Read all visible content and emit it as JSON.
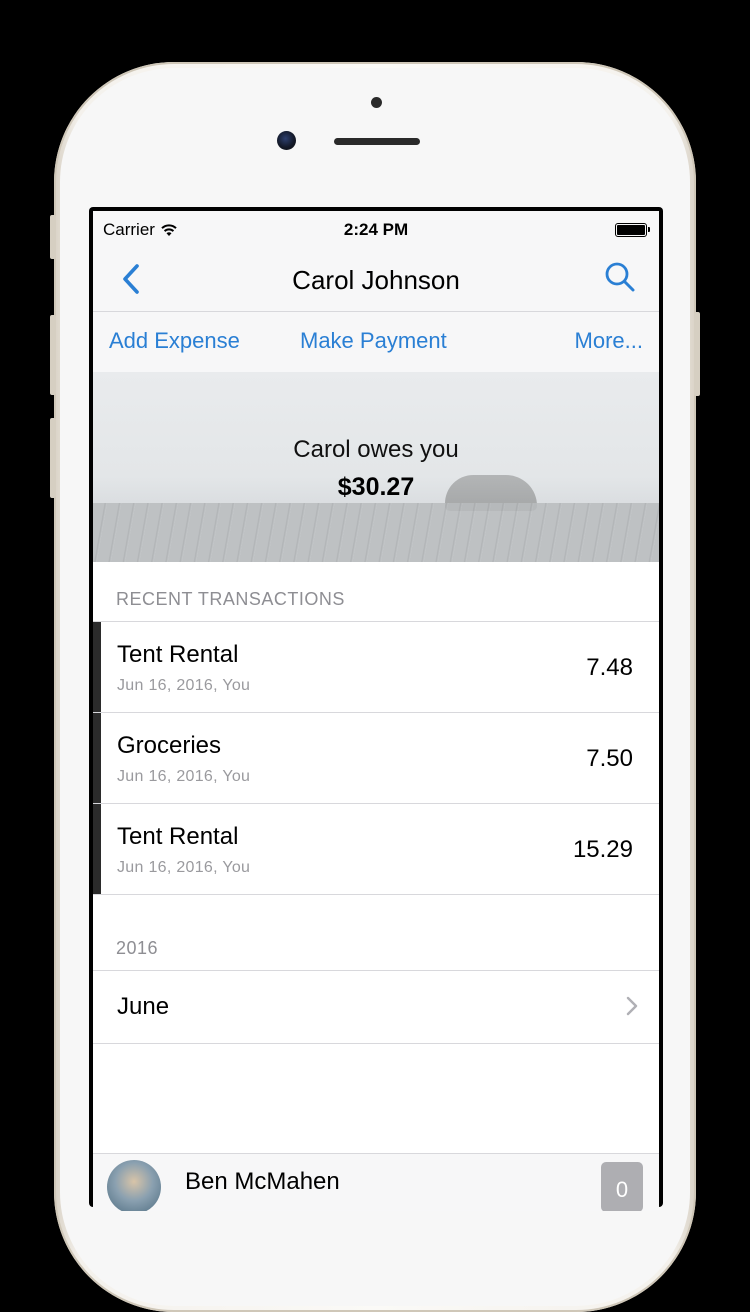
{
  "status_bar": {
    "carrier": "Carrier",
    "time": "2:24 PM"
  },
  "nav": {
    "title": "Carol Johnson",
    "back_icon": "chevron-left-icon",
    "search_icon": "search-icon"
  },
  "actions": {
    "add_expense": "Add Expense",
    "make_payment": "Make Payment",
    "more": "More..."
  },
  "balance": {
    "message": "Carol owes you",
    "amount": "$30.27"
  },
  "recent": {
    "header": "RECENT TRANSACTIONS",
    "items": [
      {
        "title": "Tent Rental",
        "subtitle": "Jun 16, 2016, You",
        "amount": "7.48"
      },
      {
        "title": "Groceries",
        "subtitle": "Jun 16, 2016, You",
        "amount": "7.50"
      },
      {
        "title": "Tent Rental",
        "subtitle": "Jun 16, 2016, You",
        "amount": "15.29"
      }
    ]
  },
  "history": {
    "year_header": "2016",
    "month": "June"
  },
  "bottom_bar": {
    "name": "Ben McMahen",
    "badge_count": "0"
  },
  "colors": {
    "accent": "#2a7fd4",
    "row_indicator": "#2b2b2b",
    "secondary_text": "#8e8e93"
  }
}
